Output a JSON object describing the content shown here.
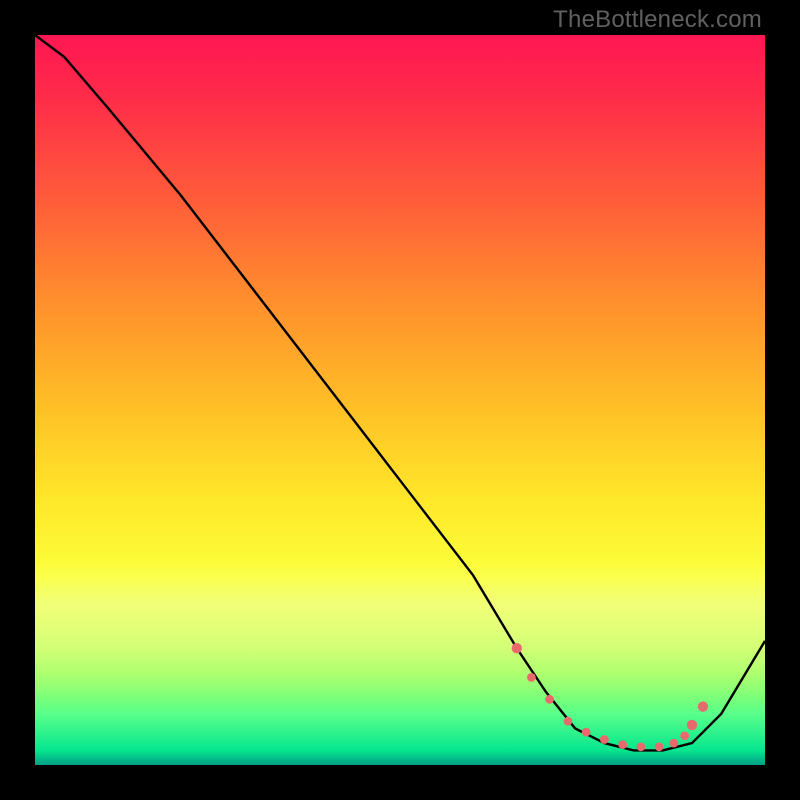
{
  "watermark": "TheBottleneck.com",
  "chart_data": {
    "type": "line",
    "title": "",
    "xlabel": "",
    "ylabel": "",
    "xlim": [
      0,
      100
    ],
    "ylim": [
      0,
      100
    ],
    "series": [
      {
        "name": "curve",
        "x": [
          0,
          4,
          10,
          20,
          30,
          40,
          50,
          60,
          66,
          70,
          74,
          78,
          82,
          86,
          90,
          94,
          100
        ],
        "y": [
          100,
          97,
          90,
          78,
          65,
          52,
          39,
          26,
          16,
          10,
          5,
          3,
          2,
          2,
          3,
          7,
          17
        ]
      }
    ],
    "markers": {
      "name": "highlight-points",
      "color": "#e96a6d",
      "x": [
        66.0,
        68.0,
        70.5,
        73.0,
        75.5,
        78.0,
        80.5,
        83.0,
        85.5,
        87.5,
        89.0,
        90.0,
        91.5
      ],
      "y": [
        16.0,
        12.0,
        9.0,
        6.0,
        4.5,
        3.5,
        2.8,
        2.5,
        2.5,
        3.0,
        4.0,
        5.5,
        8.0
      ],
      "r": [
        5.2,
        4.4,
        4.4,
        4.4,
        4.4,
        4.4,
        4.4,
        4.4,
        4.4,
        4.4,
        4.4,
        5.2,
        5.2
      ]
    }
  }
}
